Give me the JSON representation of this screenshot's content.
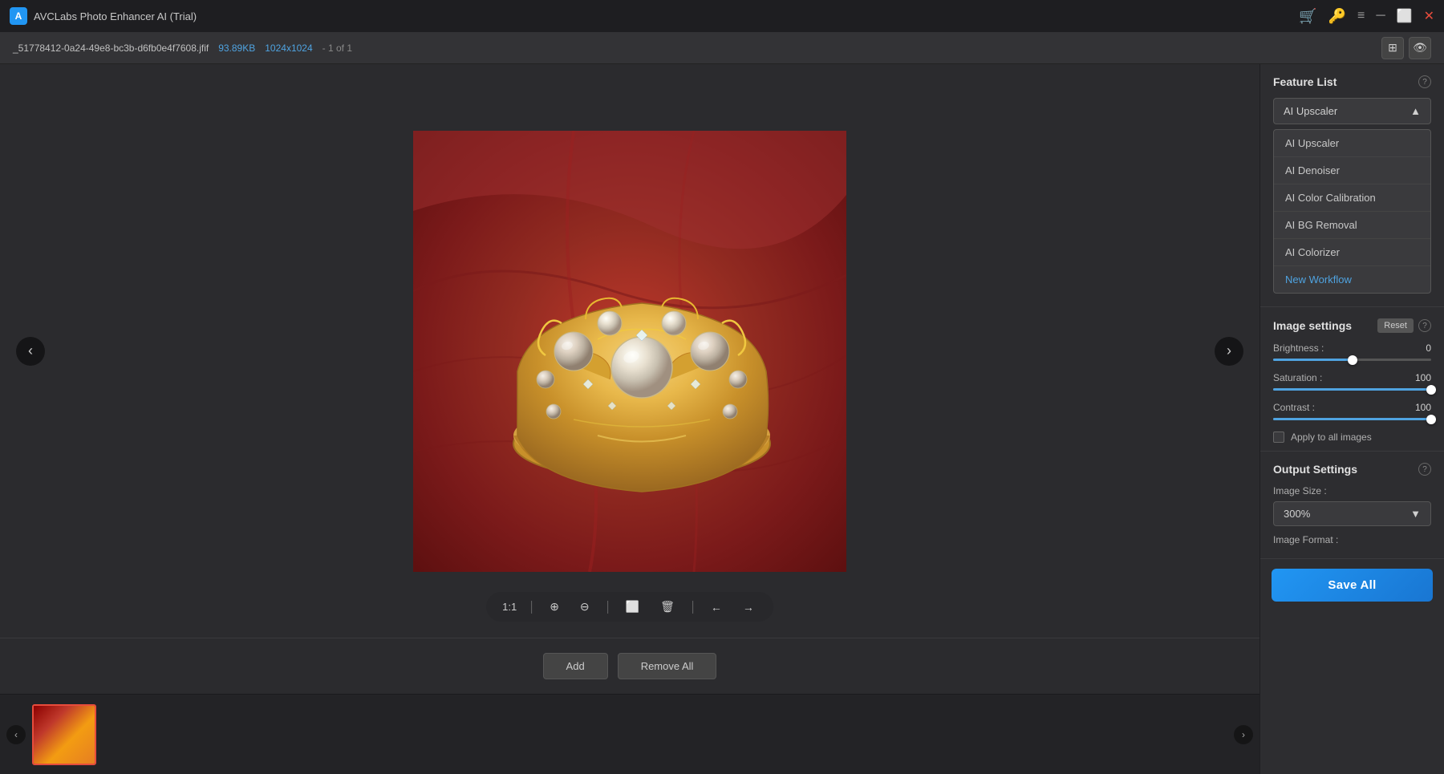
{
  "titleBar": {
    "appName": "AVCLabs Photo Enhancer AI (Trial)",
    "appIconText": "A",
    "iconColors": {
      "cart": "#f5a623",
      "key": "#f5a623"
    }
  },
  "fileBar": {
    "filename": "_51778412-0a24-49e8-bc3b-d6fb0e4f7608.jfif",
    "filesize": "93.89KB",
    "dimensions": "1024x1024",
    "count": "- 1 of 1"
  },
  "imageControls": {
    "zoom": "1:1",
    "zoomIn": "+",
    "zoomOut": "-",
    "crop": "⬜",
    "delete": "🗑",
    "prevArrow": "←",
    "nextArrow": "→"
  },
  "bottomBar": {
    "addLabel": "Add",
    "removeAllLabel": "Remove All"
  },
  "featureList": {
    "title": "Feature List",
    "selectedItem": "AI Upscaler",
    "items": [
      {
        "id": "ai-upscaler",
        "label": "AI Upscaler"
      },
      {
        "id": "ai-denoiser",
        "label": "AI Denoiser"
      },
      {
        "id": "ai-color-calibration",
        "label": "AI Color Calibration"
      },
      {
        "id": "ai-bg-removal",
        "label": "AI BG Removal"
      },
      {
        "id": "ai-colorizer",
        "label": "AI Colorizer"
      }
    ],
    "newWorkflow": "New Workflow"
  },
  "imageSettings": {
    "title": "Image settings",
    "resetLabel": "Reset",
    "brightness": {
      "label": "Brightness :",
      "value": "0",
      "percent": 50
    },
    "saturation": {
      "label": "Saturation :",
      "value": "100",
      "percent": 100
    },
    "contrast": {
      "label": "Contrast :",
      "value": "100",
      "percent": 100
    },
    "applyToAll": {
      "label": "Apply to all images",
      "checked": false
    }
  },
  "outputSettings": {
    "title": "Output Settings",
    "imageSizeLabel": "Image Size :",
    "imageSizeValue": "300%",
    "imageFormatLabel": "Image Format :"
  },
  "saveAll": {
    "label": "Save All"
  },
  "navArrows": {
    "left": "‹",
    "right": "›"
  }
}
